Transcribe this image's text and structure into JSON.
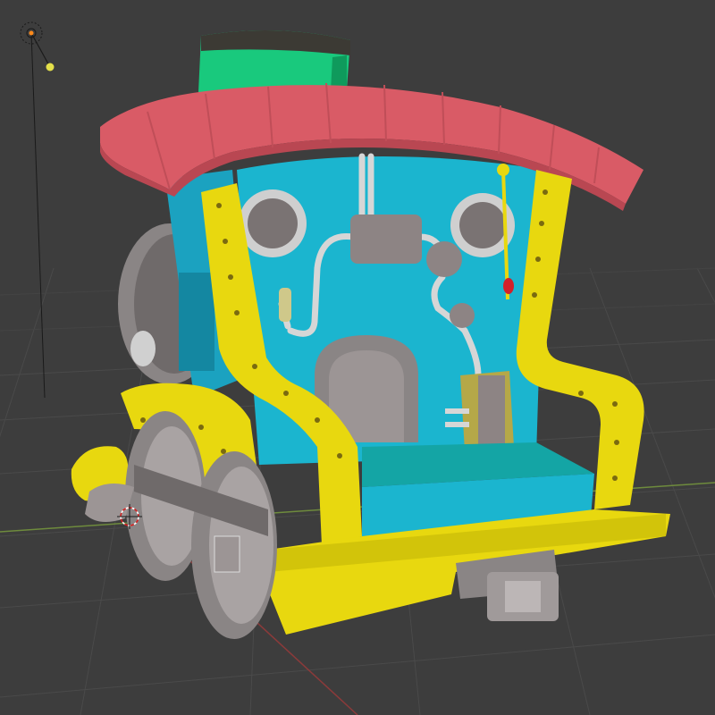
{
  "viewport": {
    "background": "#3d3d3d",
    "grid_color": "#4a4a4a",
    "x_axis_color": "#8b3a3a",
    "y_axis_color": "#6e8b3d"
  },
  "scene_objects": [
    {
      "name": "light",
      "icon": "sun-lamp-icon"
    },
    {
      "name": "locomotive",
      "icon": "mesh-object-icon"
    },
    {
      "name": "3d-cursor",
      "icon": "cursor-target-icon"
    }
  ],
  "colors": {
    "roof": "#d95b66",
    "frame": "#e8d80f",
    "cab": "#1bb5cf",
    "chimney": "#19c97d",
    "metal": "#8a8585",
    "pipes": "#d0d0d0",
    "seat": "#1aaebe",
    "tank": "#b5a848"
  }
}
